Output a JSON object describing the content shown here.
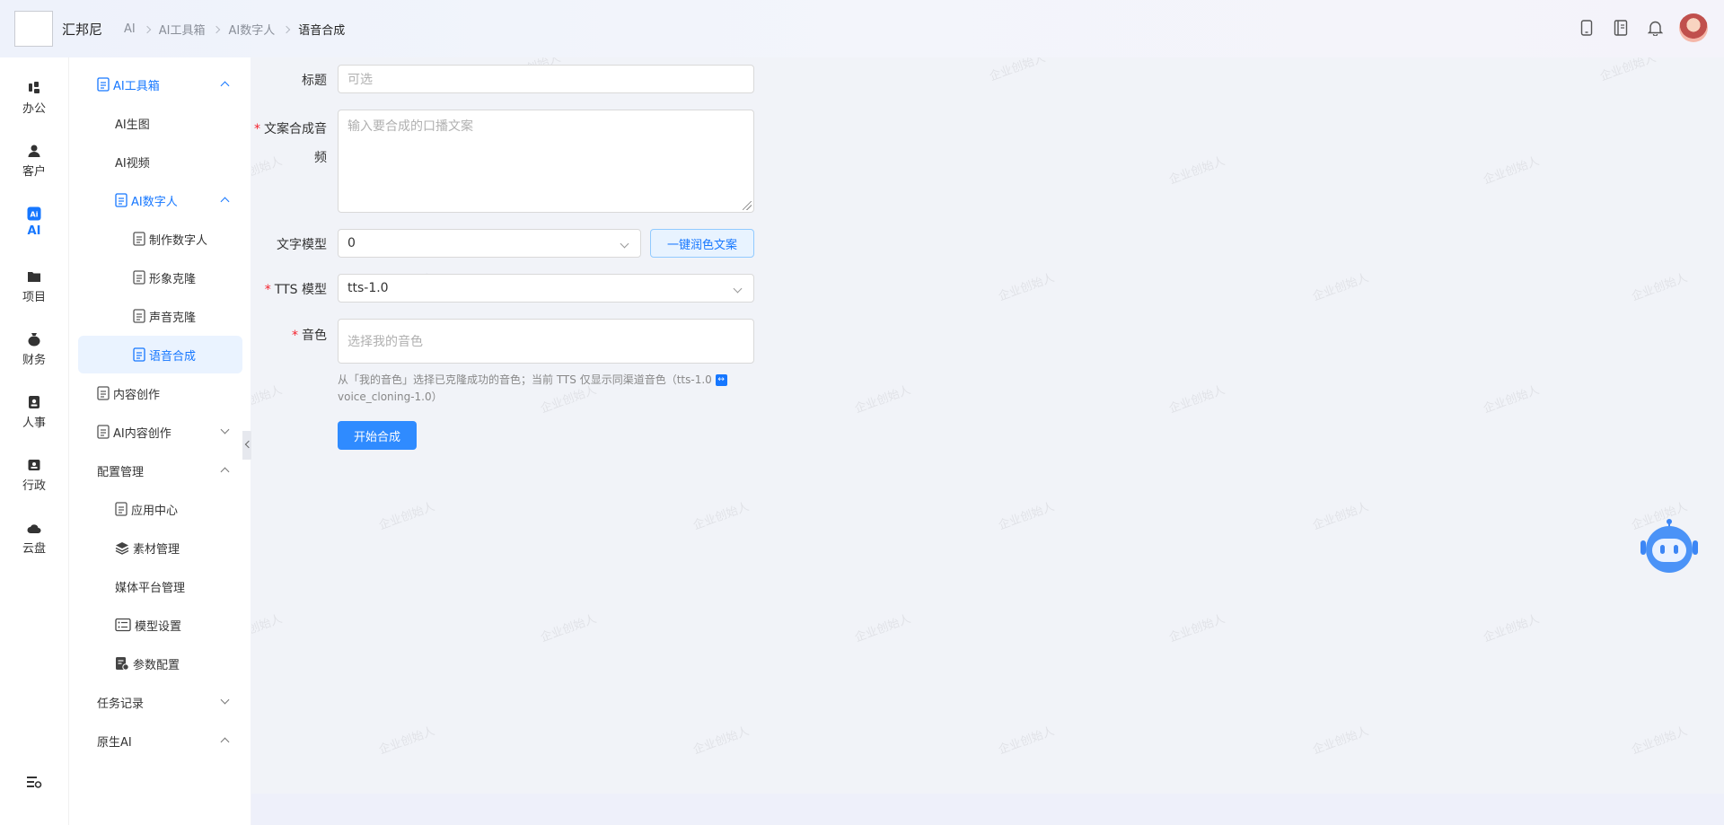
{
  "header": {
    "app_name": "汇邦尼",
    "breadcrumb": [
      "AI",
      "AI工具箱",
      "AI数字人",
      "语音合成"
    ],
    "icons": [
      "phone-icon",
      "book-icon",
      "bell-icon"
    ]
  },
  "leftnav": {
    "items": [
      {
        "label": "办公",
        "icon": "office-icon"
      },
      {
        "label": "客户",
        "icon": "customer-icon"
      },
      {
        "label": "AI",
        "icon": "ai-icon",
        "active": true
      },
      {
        "label": "项目",
        "icon": "folder-icon"
      },
      {
        "label": "财务",
        "icon": "money-bag-icon"
      },
      {
        "label": "人事",
        "icon": "badge-icon"
      },
      {
        "label": "行政",
        "icon": "admin-icon"
      },
      {
        "label": "云盘",
        "icon": "cloud-icon"
      }
    ]
  },
  "sidebar": {
    "ai_toolbox": "AI工具箱",
    "ai_image": "AI生图",
    "ai_video": "AI视频",
    "ai_digital_human": "AI数字人",
    "make_digital_human": "制作数字人",
    "image_clone": "形象克隆",
    "voice_clone": "声音克隆",
    "speech_synthesis": "语音合成",
    "content_creation": "内容创作",
    "ai_content_creation": "AI内容创作",
    "config_management": "配置管理",
    "app_center": "应用中心",
    "material_management": "素材管理",
    "media_platform": "媒体平台管理",
    "model_settings": "模型设置",
    "param_config": "参数配置",
    "task_records": "任务记录",
    "native_ai": "原生AI"
  },
  "form": {
    "title_label": "标题",
    "title_placeholder": "可选",
    "copy_label_line1": "文案合成音",
    "copy_label_line2": "频",
    "copy_placeholder": "输入要合成的口播文案",
    "text_model_label": "文字模型",
    "text_model_value": "0",
    "polish_button": "一键润色文案",
    "tts_label": "TTS 模型",
    "tts_value": "tts-1.0",
    "voice_label": "音色",
    "voice_placeholder": "选择我的音色",
    "hint_line1": "从「我的音色」选择已克隆成功的音色；当前 TTS 仅显示同渠道音色（tts-1.0",
    "hint_tag": "↔",
    "hint_line2": "voice_cloning-1.0）",
    "start_button": "开始合成"
  },
  "watermark_text": "企业创始人",
  "colors": {
    "accent": "#1677ff",
    "primary_button": "#2f8bff",
    "required": "#f5222d"
  }
}
